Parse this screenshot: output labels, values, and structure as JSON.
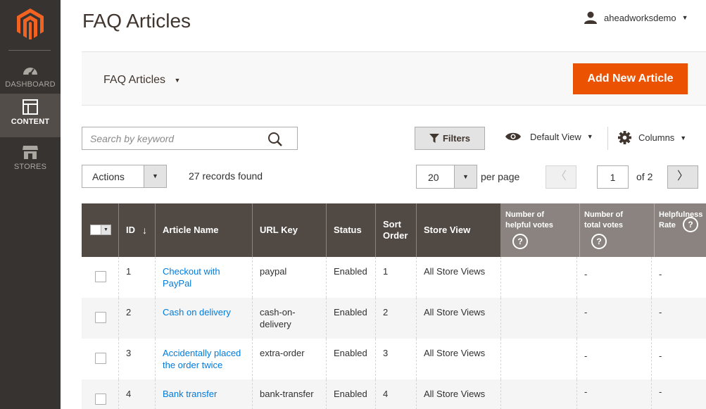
{
  "sidebar": {
    "logo": "magento-logo",
    "items": [
      {
        "label": "DASHBOARD",
        "icon": "dashboard-icon",
        "active": false
      },
      {
        "label": "CONTENT",
        "icon": "content-icon",
        "active": true
      },
      {
        "label": "STORES",
        "icon": "stores-icon",
        "active": false
      }
    ]
  },
  "header": {
    "title": "FAQ Articles",
    "user": "aheadworksdemo"
  },
  "actionbar": {
    "switcher": "FAQ Articles",
    "add_button": "Add New Article"
  },
  "toolbar": {
    "search_placeholder": "Search by keyword",
    "filters": "Filters",
    "view": "Default View",
    "columns": "Columns",
    "actions": "Actions",
    "records": "27 records found",
    "per_page_value": "20",
    "per_page_label": "per page",
    "page": "1",
    "of_pages": "of 2"
  },
  "grid": {
    "headers": {
      "id": "ID",
      "name": "Article Name",
      "url": "URL Key",
      "status": "Status",
      "sort": "Sort Order",
      "store": "Store View",
      "helpful": "Number of helpful votes",
      "total": "Number of total votes",
      "rate": "Helpfulness Rate"
    },
    "rows": [
      {
        "id": "1",
        "name": "Checkout with PayPal",
        "url": "paypal",
        "status": "Enabled",
        "sort": "1",
        "store": "All Store Views",
        "helpful": "",
        "total": "-",
        "rate": "-"
      },
      {
        "id": "2",
        "name": "Cash on delivery",
        "url": "cash-on-delivery",
        "status": "Enabled",
        "sort": "2",
        "store": "All Store Views",
        "helpful": "",
        "total": "-",
        "rate": "-"
      },
      {
        "id": "3",
        "name": "Accidentally placed the order twice",
        "url": "extra-order",
        "status": "Enabled",
        "sort": "3",
        "store": "All Store Views",
        "helpful": "",
        "total": "-",
        "rate": "-"
      },
      {
        "id": "4",
        "name": "Bank transfer",
        "url": "bank-transfer",
        "status": "Enabled",
        "sort": "4",
        "store": "All Store Views",
        "helpful": "",
        "total": "-",
        "rate": "-"
      }
    ]
  },
  "colors": {
    "sidebar_bg": "#373330",
    "accent": "#eb5202",
    "header_dark": "#514943",
    "header_light": "#8a837f",
    "link": "#007bdb"
  }
}
